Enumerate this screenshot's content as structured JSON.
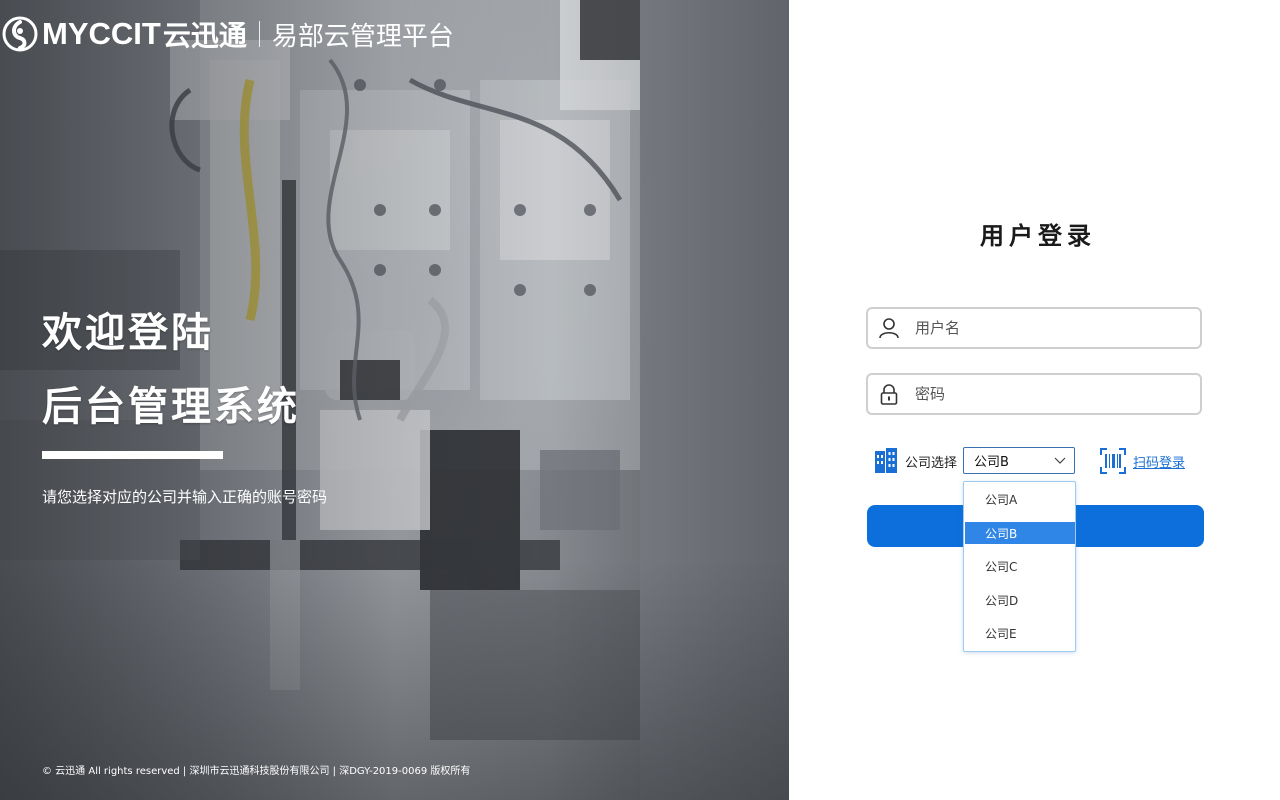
{
  "brand": {
    "name_latin": "MYCCIT",
    "name_cn": "云迅通",
    "product": "易部云管理平台"
  },
  "hero": {
    "welcome_line1": "欢迎登陆",
    "welcome_line2": "后台管理系统",
    "subtitle": "请您选择对应的公司并输入正确的账号密码",
    "copyright": "© 云迅通 All rights reserved | 深圳市云迅通科技股份有限公司 | 深DGY-2019-0069 版权所有"
  },
  "login": {
    "title": "用户登录",
    "username": {
      "placeholder": "用户名",
      "value": "",
      "icon": "user-icon"
    },
    "password": {
      "placeholder": "密码",
      "value": "",
      "icon": "lock-icon"
    },
    "company": {
      "label": "公司选择",
      "icon": "building-icon",
      "selected": "公司B",
      "options": [
        "公司A",
        "公司B",
        "公司C",
        "公司D",
        "公司E"
      ],
      "expanded": true
    },
    "qr_login": {
      "label": "扫码登录",
      "icon": "barcode-icon"
    },
    "submit_label": ""
  },
  "colors": {
    "accent": "#0c6fdc",
    "link": "#1a6fd4",
    "dropdown_selected": "#2f86e6",
    "field_border": "#cfcfcf"
  }
}
